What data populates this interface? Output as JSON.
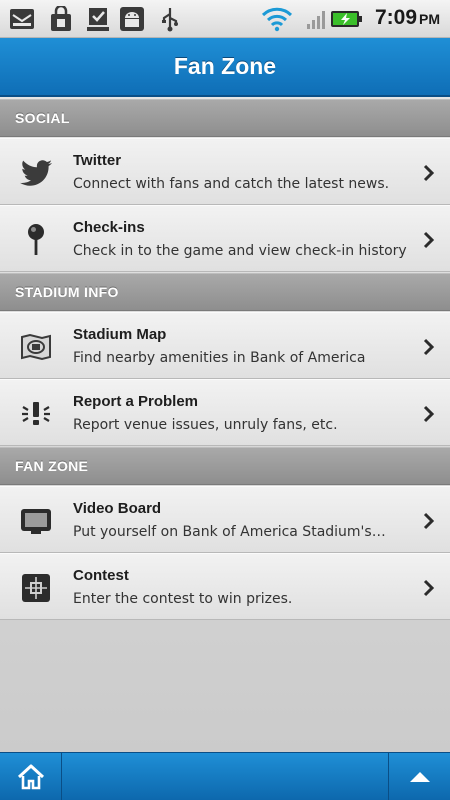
{
  "status_bar": {
    "time": "7:09",
    "ampm": "PM",
    "icons": [
      "mail-notification-icon",
      "shopping-bag-icon",
      "download-done-icon",
      "android-icon",
      "usb-icon",
      "wifi-icon",
      "signal-icon",
      "battery-charging-icon"
    ]
  },
  "header": {
    "title": "Fan Zone"
  },
  "sections": [
    {
      "label": "SOCIAL",
      "items": [
        {
          "title": "Twitter",
          "subtitle": "Connect with fans and catch the latest news.",
          "icon": "twitter-bird-icon"
        },
        {
          "title": "Check-ins",
          "subtitle": "Check in to the game and view check-in history",
          "icon": "map-pin-icon"
        }
      ]
    },
    {
      "label": "STADIUM INFO",
      "items": [
        {
          "title": "Stadium Map",
          "subtitle": "Find nearby amenities in Bank of America",
          "icon": "stadium-map-icon"
        },
        {
          "title": "Report a Problem",
          "subtitle": "Report venue issues, unruly fans, etc.",
          "icon": "alert-exclamation-icon"
        }
      ]
    },
    {
      "label": "FAN ZONE",
      "items": [
        {
          "title": "Video Board",
          "subtitle": "Put yourself on Bank of America Stadium's…",
          "icon": "video-board-icon"
        },
        {
          "title": "Contest",
          "subtitle": "Enter the contest to win prizes.",
          "icon": "contest-crosshair-icon"
        }
      ]
    }
  ],
  "bottom_bar": {
    "left_icon": "home-icon",
    "right_icon": "up-arrow-icon"
  },
  "colors": {
    "accent": "#1478c4",
    "section_gray": "#9a9a9a"
  }
}
